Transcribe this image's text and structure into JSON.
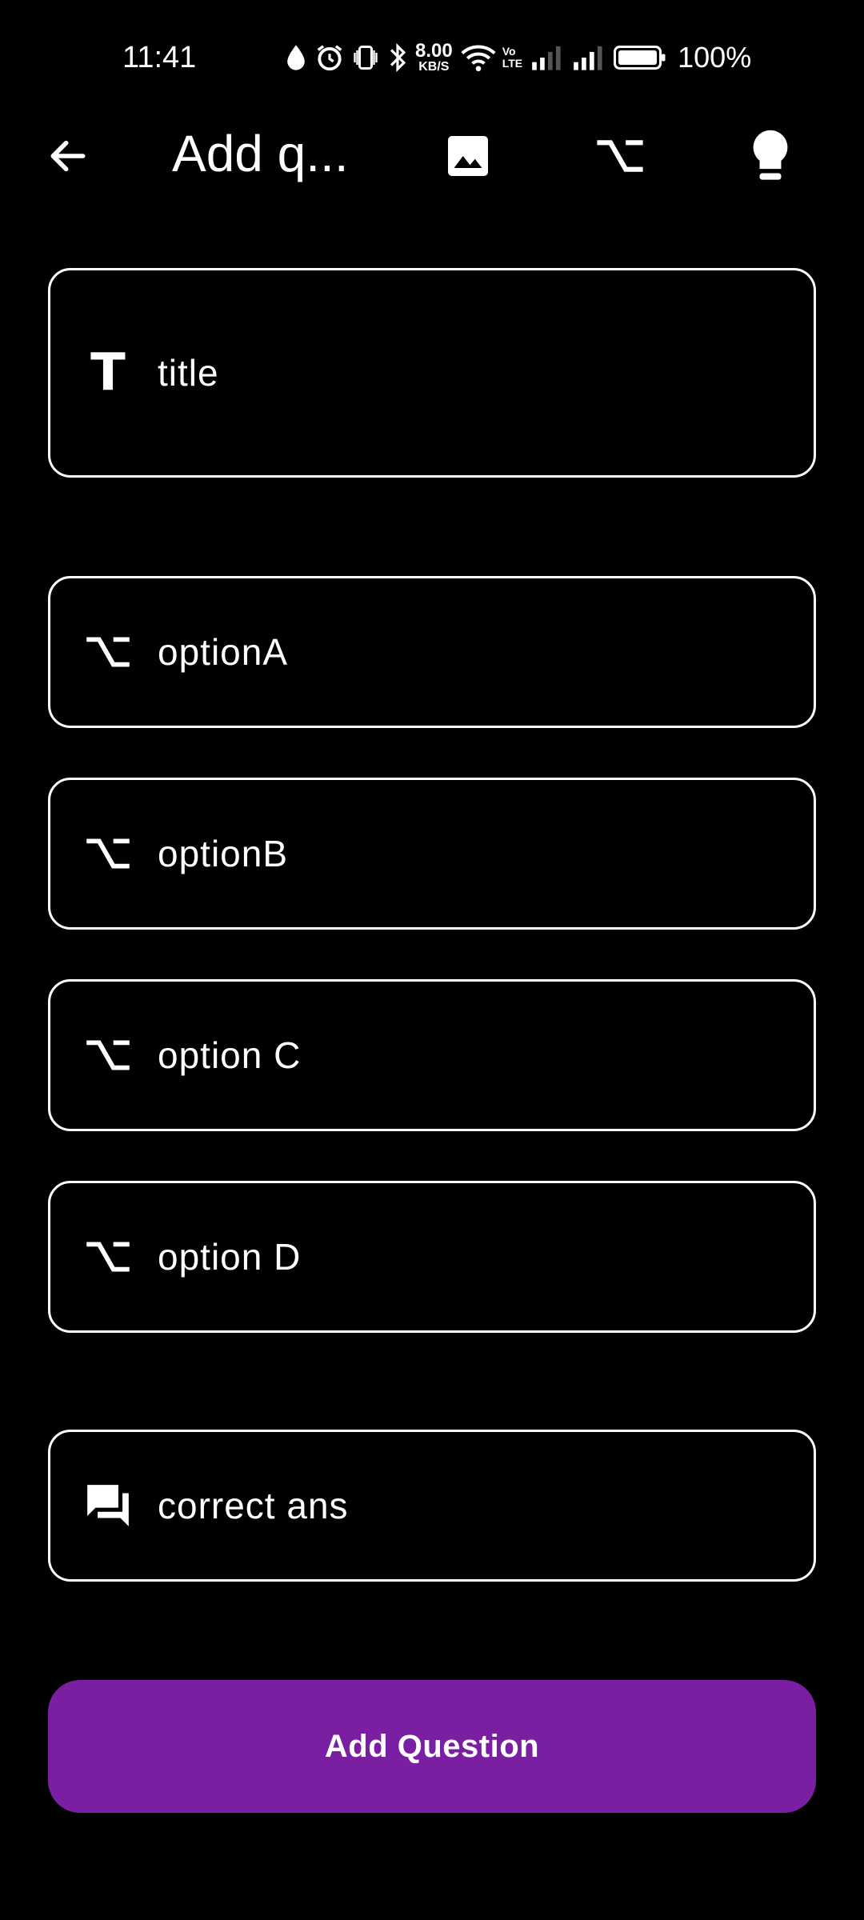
{
  "status_bar": {
    "time": "11:41",
    "net_speed_value": "8.00",
    "net_speed_unit": "KB/S",
    "volte_top": "Vo",
    "volte_bottom": "LTE",
    "battery_percent": "100%"
  },
  "app_bar": {
    "title": "Add q...",
    "icons": [
      "back-arrow-icon",
      "image-icon",
      "option-icon",
      "lightbulb-icon"
    ]
  },
  "form": {
    "title_field": {
      "placeholder": "title",
      "icon": "text-icon"
    },
    "options": [
      {
        "placeholder": "optionA",
        "icon": "option-icon"
      },
      {
        "placeholder": "optionB",
        "icon": "option-icon"
      },
      {
        "placeholder": "option C",
        "icon": "option-icon"
      },
      {
        "placeholder": "option D",
        "icon": "option-icon"
      }
    ],
    "answer_field": {
      "placeholder": "correct ans",
      "icon": "chat-icon"
    },
    "submit_label": "Add Question"
  },
  "colors": {
    "background": "#000000",
    "foreground": "#ffffff",
    "accent": "#7b1fa2"
  }
}
